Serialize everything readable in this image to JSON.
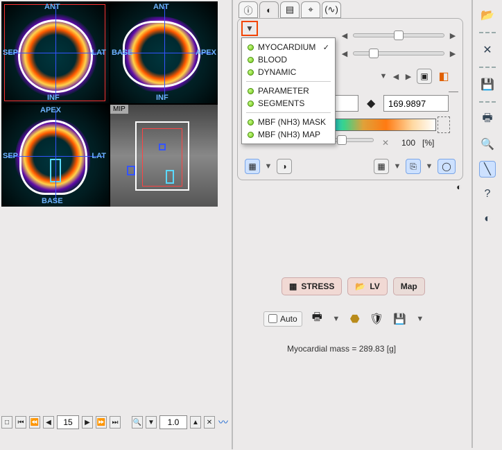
{
  "viewports": {
    "sax": {
      "top": "ANT",
      "left": "SEP",
      "right": "LAT",
      "bottom": "INF"
    },
    "hla": {
      "top": "ANT",
      "left": "BASE",
      "right": "APEX",
      "bottom": "INF"
    },
    "vla": {
      "top": "APEX",
      "left": "SEP",
      "right": "LAT",
      "bottom": "BASE"
    },
    "mip": {
      "tag": "MIP"
    }
  },
  "nav": {
    "frame": "15",
    "zoom": "1.0"
  },
  "dropdown": {
    "items": [
      {
        "label": "MYOCARDIUM",
        "checked": true
      },
      {
        "label": "BLOOD",
        "checked": false
      },
      {
        "label": "DYNAMIC",
        "checked": false
      }
    ],
    "items2": [
      {
        "label": "PARAMETER",
        "checked": false
      },
      {
        "label": "SEGMENTS",
        "checked": false
      }
    ],
    "items3": [
      {
        "label": "MBF (NH3) MASK",
        "checked": false
      },
      {
        "label": "MBF (NH3) MAP",
        "checked": false
      }
    ]
  },
  "values": {
    "threshold": "169.9897",
    "opacity_num": "100",
    "opacity_unit": "[%]"
  },
  "buttons": {
    "stress": "STRESS",
    "lv": "LV",
    "map": "Map",
    "auto": "Auto"
  },
  "mass": {
    "label": "Myocardial mass = ",
    "value": "289.83",
    "unit": "[g]"
  },
  "toolbar_icons": {
    "open": "📂",
    "close": "✕",
    "save": "💾",
    "print_layout": "🖶",
    "zoom": "🔍",
    "segment": "╲",
    "help": "?",
    "contrast": "◐"
  }
}
